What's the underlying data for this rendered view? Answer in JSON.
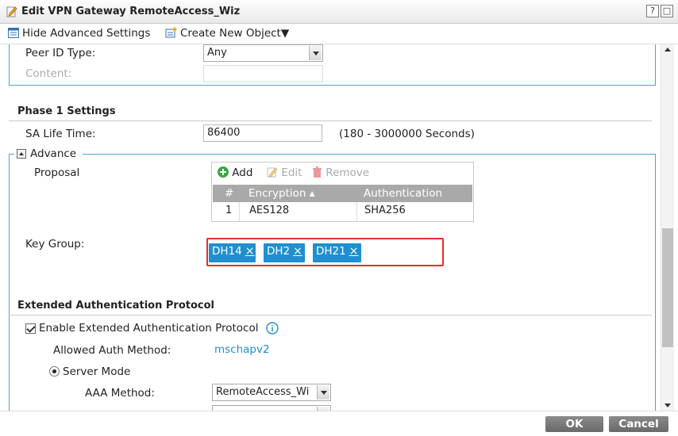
{
  "window": {
    "title": "Edit VPN Gateway RemoteAccess_Wiz",
    "help_btn": "?",
    "max_btn": "□"
  },
  "toolbar": {
    "hide_advanced": "Hide Advanced Settings",
    "create_object": "Create New Object▼"
  },
  "peer": {
    "id_type_label": "Peer ID Type:",
    "id_type_value": "Any",
    "content_label": "Content:"
  },
  "phase1": {
    "title": "Phase 1 Settings",
    "sa_life_label": "SA Life Time:",
    "sa_life_value": "86400",
    "sa_life_hint": "(180 - 3000000 Seconds)",
    "advance_label": "Advance",
    "proposal_label": "Proposal",
    "proposal_toolbar": {
      "add": "Add",
      "edit": "Edit",
      "remove": "Remove"
    },
    "proposal_columns": [
      "#",
      "Encryption ▴",
      "Authentication"
    ],
    "proposal_rows": [
      {
        "num": "1",
        "encryption": "AES128",
        "auth": "SHA256"
      }
    ],
    "key_group_label": "Key Group:",
    "key_groups": [
      "DH14",
      "DH2",
      "DH21"
    ],
    "tag_remove": "×"
  },
  "xauth": {
    "title": "Extended Authentication Protocol",
    "enable_label": "Enable Extended Authentication Protocol",
    "allowed_label": "Allowed Auth Method:",
    "allowed_value": "mschapv2",
    "server_mode_label": "Server Mode",
    "aaa_label": "AAA Method:",
    "aaa_value": "RemoteAccess_Wi"
  },
  "footer": {
    "ok": "OK",
    "cancel": "Cancel"
  },
  "colors": {
    "accent": "#1f8fd0",
    "highlight": "#e03030",
    "fieldset": "#4aa6c8"
  }
}
